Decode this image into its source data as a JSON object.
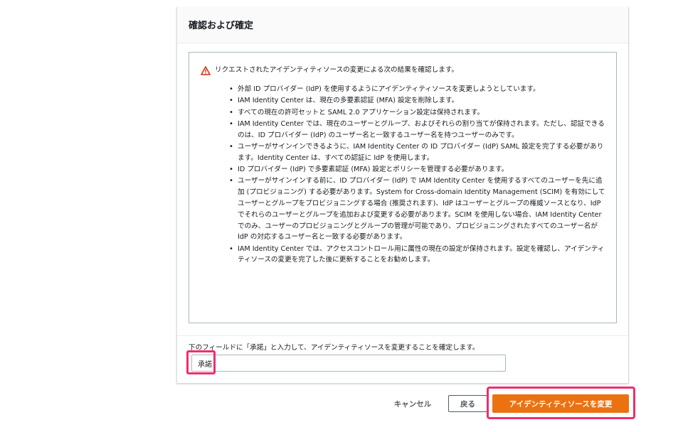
{
  "panel": {
    "title": "確認および確定"
  },
  "alert": {
    "heading": "リクエストされたアイデンティティソースの変更による次の結果を確認します。",
    "items": [
      "外部 ID プロバイダー (IdP) を使用するようにアイデンティティソースを変更しようとしています。",
      "IAM Identity Center は、現在の多要素認証 (MFA) 設定を削除します。",
      "すべての現在の許可セットと SAML 2.0 アプリケーション設定は保持されます。",
      "IAM Identity Center では、現在のユーザーとグループ、およびそれらの割り当てが保持されます。ただし、認証できるのは、ID プロバイダー (IdP) のユーザー名と一致するユーザー名を持つユーザーのみです。",
      "ユーザーがサインインできるように、IAM Identity Center の ID プロバイダー (IdP) SAML 設定を完了する必要があります。Identity Center は、すべての認証に IdP を使用します。",
      "ID プロバイダー (IdP) で多要素認証 (MFA) 設定とポリシーを管理する必要があります。",
      "ユーザーがサインインする前に、ID プロバイダー (IdP) で IAM Identity Center を使用するすべてのユーザーを先に追加 (プロビジョニング) する必要があります。System for Cross-domain Identity Management (SCIM) を有効にしてユーザーとグループをプロビジョニングする場合 (推奨されます)、IdP はユーザーとグループの権威ソースとなり、IdP でそれらのユーザーとグループを追加および変更する必要があります。SCIM を使用しない場合、IAM Identity Center でのみ、ユーザーのプロビジョニングとグループの管理が可能であり、プロビジョニングされたすべてのユーザー名が IdP の対応するユーザー名と一致する必要があります。",
      "IAM Identity Center では、アクセスコントロール用に属性の現在の設定が保持されます。設定を確認し、アイデンティティソースの変更を完了した後に更新することをお勧めします。"
    ]
  },
  "confirm": {
    "label": "下のフィールドに「承諾」と入力して、アイデンティティソースを変更することを確定します。",
    "value": "承諾"
  },
  "actions": {
    "cancel_label": "キャンセル",
    "back_label": "戻る",
    "submit_label": "アイデンティティソースを変更"
  },
  "colors": {
    "primary": "#ec7211",
    "highlight": "#ee2e6f",
    "warning": "#d13212"
  }
}
